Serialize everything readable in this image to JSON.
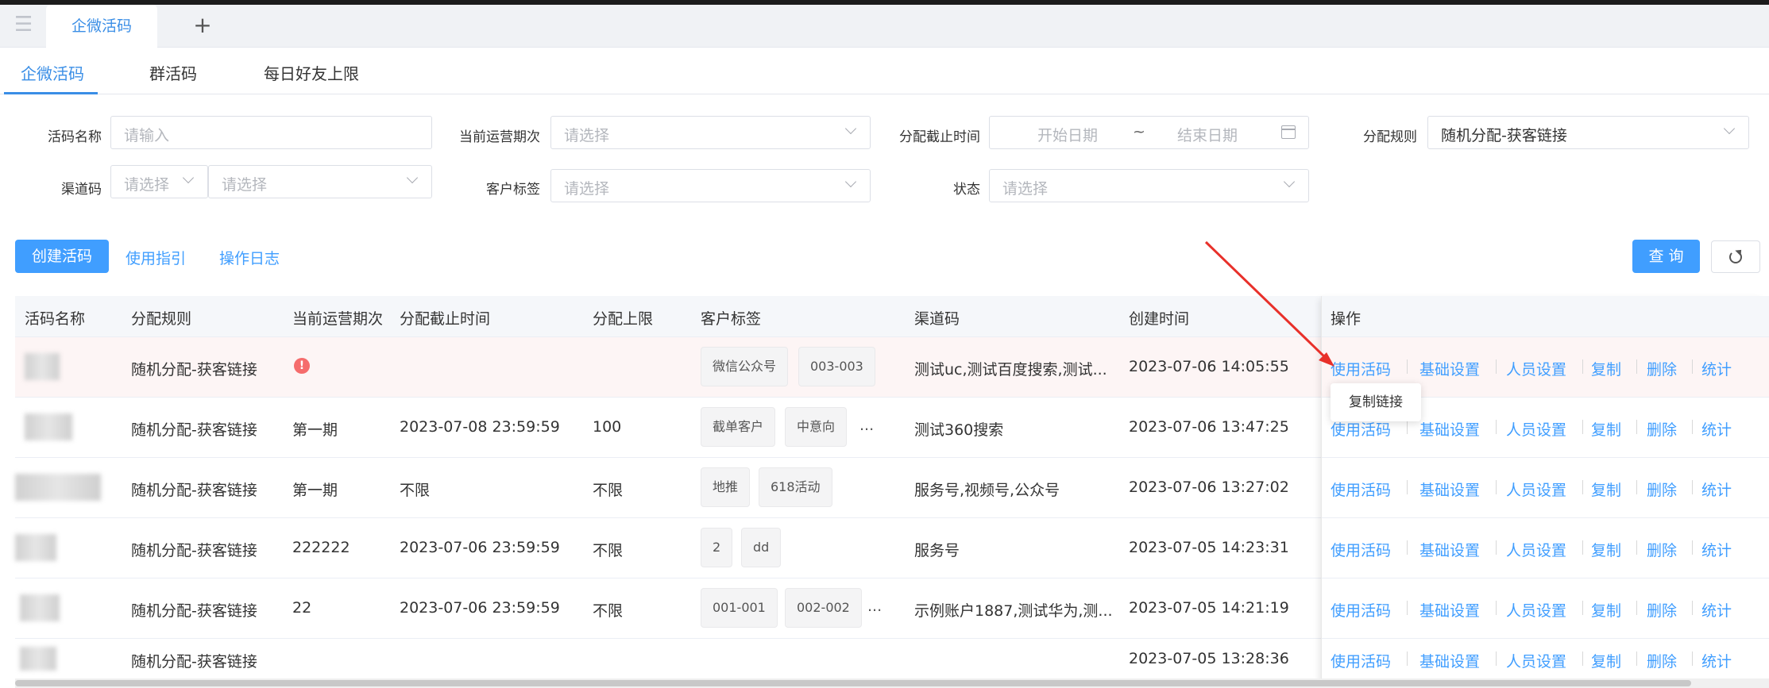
{
  "tabbar": {
    "active_tab": "企微活码",
    "add_label": "+"
  },
  "subtabs": [
    {
      "label": "企微活码",
      "active": true
    },
    {
      "label": "群活码",
      "active": false
    },
    {
      "label": "每日好友上限",
      "active": false
    }
  ],
  "filters": {
    "name": {
      "label": "活码名称",
      "placeholder": "请输入"
    },
    "period": {
      "label": "当前运营期次",
      "placeholder": "请选择"
    },
    "deadline": {
      "label": "分配截止时间",
      "start_placeholder": "开始日期",
      "separator": "~",
      "end_placeholder": "结束日期"
    },
    "rule": {
      "label": "分配规则",
      "value": "随机分配-获客链接"
    },
    "channel": {
      "label": "渠道码",
      "placeholder1": "请选择",
      "placeholder2": "请选择"
    },
    "tag": {
      "label": "客户标签",
      "placeholder": "请选择"
    },
    "status": {
      "label": "状态",
      "placeholder": "请选择"
    }
  },
  "actions": {
    "create": "创建活码",
    "guide": "使用指引",
    "log": "操作日志",
    "query": "查 询"
  },
  "table": {
    "columns": [
      "活码名称",
      "分配规则",
      "当前运营期次",
      "分配截止时间",
      "分配上限",
      "客户标签",
      "渠道码",
      "创建时间",
      "操作"
    ],
    "rows": [
      {
        "rule": "随机分配-获客链接",
        "period": "",
        "deadline": "",
        "limit": "",
        "tags": [
          "微信公众号",
          "003-003"
        ],
        "more": "",
        "channel": "测试uc,测试百度搜索,测试...",
        "created": "2023-07-06 14:05:55"
      },
      {
        "rule": "随机分配-获客链接",
        "period": "第一期",
        "deadline": "2023-07-08 23:59:59",
        "limit": "100",
        "tags": [
          "截单客户",
          "中意向"
        ],
        "more": "...",
        "channel": "测试360搜索",
        "created": "2023-07-06 13:47:25"
      },
      {
        "rule": "随机分配-获客链接",
        "period": "第一期",
        "deadline": "不限",
        "limit": "不限",
        "tags": [
          "地推",
          "618活动"
        ],
        "more": "",
        "channel": "服务号,视频号,公众号",
        "created": "2023-07-06 13:27:02"
      },
      {
        "rule": "随机分配-获客链接",
        "period": "222222",
        "deadline": "2023-07-06 23:59:59",
        "limit": "不限",
        "tags": [
          "2",
          "dd"
        ],
        "more": "",
        "channel": "服务号",
        "created": "2023-07-05 14:23:31"
      },
      {
        "rule": "随机分配-获客链接",
        "period": "22",
        "deadline": "2023-07-06 23:59:59",
        "limit": "不限",
        "tags": [
          "001-001",
          "002-002"
        ],
        "more": "...",
        "channel": "示例账户1887,测试华为,测...",
        "created": "2023-07-05 14:21:19"
      },
      {
        "rule": "随机分配-获客链接",
        "period": "",
        "deadline": "",
        "limit": "",
        "tags": [],
        "more": "",
        "channel": "",
        "created": "2023-07-05 13:28:36"
      }
    ],
    "ops": [
      "使用活码",
      "基础设置",
      "人员设置",
      "复制",
      "删除",
      "统计"
    ]
  },
  "tooltip": "复制链接",
  "colors": {
    "primary": "#409eff",
    "annotation_arrow": "#e8302a",
    "row_highlight": "#fdf5f5"
  }
}
